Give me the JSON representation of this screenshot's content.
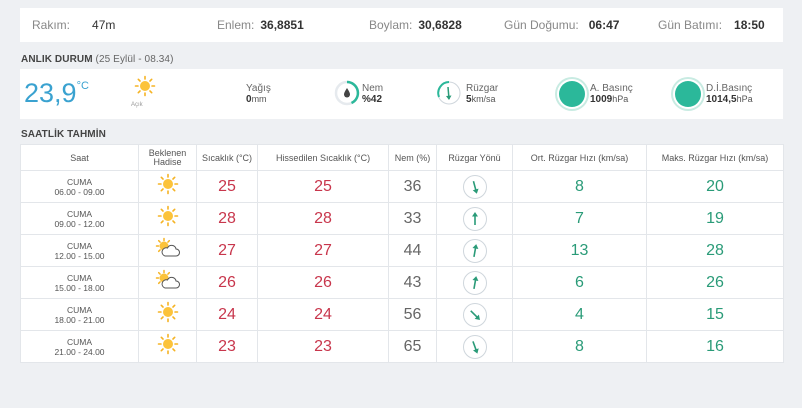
{
  "info": {
    "rakim_label": "Rakım:",
    "rakim_value": "47m",
    "enlem_label": "Enlem:",
    "enlem_value": "36,8851",
    "boylam_label": "Boylam:",
    "boylam_value": "30,6828",
    "gundogumu_label": "Gün Doğumu:",
    "gundogumu_value": "06:47",
    "gunbatimi_label": "Gün Batımı:",
    "gunbatimi_value": "18:50"
  },
  "current": {
    "title": "ANLIK DURUM",
    "subtitle": "(25 Eylül - 08.34)",
    "temp": "23,9",
    "temp_unit": "°C",
    "desc": "Açık",
    "rain_label": "Yağış",
    "rain_value": "0",
    "rain_unit": "mm",
    "hum_label": "Nem",
    "hum_value": "%42",
    "wind_label": "Rüzgar",
    "wind_value": "5",
    "wind_unit": "km/sa",
    "pressure_label": "A. Basınç",
    "pressure_value": "1009",
    "pressure_unit": "hPa",
    "sea_pressure_label": "D.İ.Basınç",
    "sea_pressure_value": "1014,5",
    "sea_pressure_unit": "hPa"
  },
  "hourly": {
    "title": "SAATLİK TAHMİN",
    "headers": {
      "saat": "Saat",
      "hadise": "Beklenen Hadise",
      "sicaklik": "Sıcaklık (°C)",
      "hissedilen": "Hissedilen Sıcaklık (°C)",
      "nem": "Nem (%)",
      "ruzgar_yonu": "Rüzgar Yönü",
      "ort_ruzgar": "Ort. Rüzgar Hızı (km/sa)",
      "maks_ruzgar": "Maks. Rüzgar Hızı (km/sa)"
    },
    "rows": [
      {
        "day": "CUMA",
        "time": "06.00 - 09.00",
        "icon": "sun-icon",
        "temp": "25",
        "feels": "25",
        "hum": "36",
        "wind_dir_deg": 165,
        "wind_avg": "8",
        "wind_max": "20"
      },
      {
        "day": "CUMA",
        "time": "09.00 - 12.00",
        "icon": "sun-icon",
        "temp": "28",
        "feels": "28",
        "hum": "33",
        "wind_dir_deg": 0,
        "wind_avg": "7",
        "wind_max": "19"
      },
      {
        "day": "CUMA",
        "time": "12.00 - 15.00",
        "icon": "partly-cloudy-icon",
        "temp": "27",
        "feels": "27",
        "hum": "44",
        "wind_dir_deg": 10,
        "wind_avg": "13",
        "wind_max": "28"
      },
      {
        "day": "CUMA",
        "time": "15.00 - 18.00",
        "icon": "partly-cloudy-icon",
        "temp": "26",
        "feels": "26",
        "hum": "43",
        "wind_dir_deg": 10,
        "wind_avg": "6",
        "wind_max": "26"
      },
      {
        "day": "CUMA",
        "time": "18.00 - 21.00",
        "icon": "sun-icon",
        "temp": "24",
        "feels": "24",
        "hum": "56",
        "wind_dir_deg": 135,
        "wind_avg": "4",
        "wind_max": "15"
      },
      {
        "day": "CUMA",
        "time": "21.00 - 24.00",
        "icon": "sun-icon",
        "temp": "23",
        "feels": "23",
        "hum": "65",
        "wind_dir_deg": 160,
        "wind_avg": "8",
        "wind_max": "16"
      }
    ]
  },
  "colors": {
    "accent": "#3aa2d0",
    "temp_red": "#c8364c",
    "wind_green": "#2a9b78",
    "pressure_green": "#2bb89a"
  }
}
